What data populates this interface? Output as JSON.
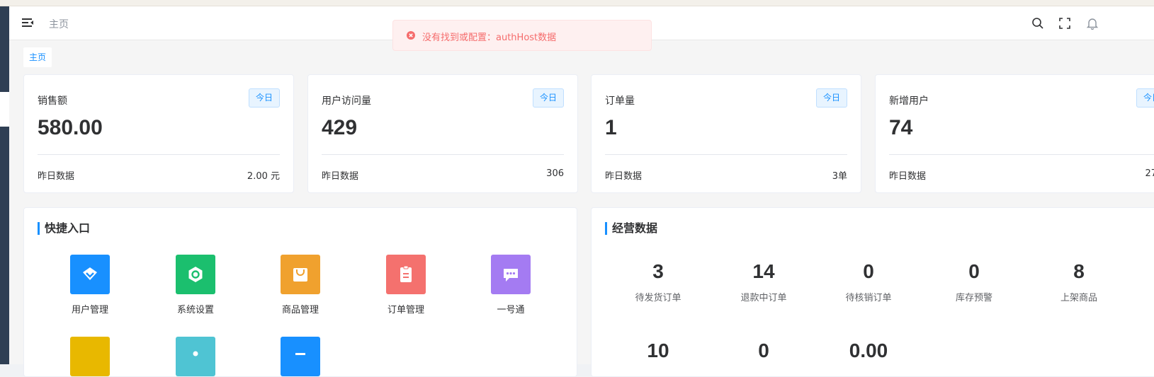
{
  "header": {
    "breadcrumb": "主页",
    "icons": [
      "menu-fold-icon",
      "search-icon",
      "fullscreen-icon",
      "bell-icon"
    ]
  },
  "tags": {
    "home": "主页"
  },
  "toast": {
    "message": "没有找到或配置：authHost数据",
    "color": "#f56c6c"
  },
  "stats": [
    {
      "title": "销售额",
      "badge": "今日",
      "value": "580.00",
      "foot_label": "昨日数据",
      "foot_value": "2.00 元"
    },
    {
      "title": "用户访问量",
      "badge": "今日",
      "value": "429",
      "foot_label": "昨日数据",
      "foot_value": "306"
    },
    {
      "title": "订单量",
      "badge": "今日",
      "value": "1",
      "foot_label": "昨日数据",
      "foot_value": "3单"
    },
    {
      "title": "新增用户",
      "badge": "今日",
      "value": "74",
      "foot_label": "昨日数据",
      "foot_value": "27"
    }
  ],
  "quick_entry": {
    "title": "快捷入口",
    "items": [
      {
        "label": "用户管理",
        "color": "#1890ff",
        "icon": "user-icon"
      },
      {
        "label": "系统设置",
        "color": "#1bbf6e",
        "icon": "settings-icon"
      },
      {
        "label": "商品管理",
        "color": "#f0a12e",
        "icon": "bag-icon"
      },
      {
        "label": "订单管理",
        "color": "#f4716e",
        "icon": "clipboard-icon"
      },
      {
        "label": "一号通",
        "color": "#a47bf2",
        "icon": "chat-icon"
      }
    ],
    "row2_colors": [
      "#e8b800",
      "#4fc4d3",
      "#1890ff"
    ]
  },
  "business": {
    "title": "经营数据",
    "items": [
      {
        "value": "3",
        "label": "待发货订单"
      },
      {
        "value": "14",
        "label": "退款中订单"
      },
      {
        "value": "0",
        "label": "待核销订单"
      },
      {
        "value": "0",
        "label": "库存预警"
      },
      {
        "value": "8",
        "label": "上架商品"
      }
    ],
    "row2_values": [
      "10",
      "0",
      "0.00"
    ]
  },
  "colors": {
    "accent": "#1890ff",
    "sidebar": "#2f3f54"
  }
}
